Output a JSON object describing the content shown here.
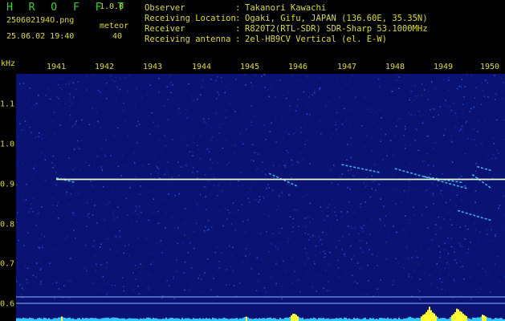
{
  "header": {
    "app_name": "H R O F F T",
    "version": "1.0.0",
    "filename": "250602194O.png",
    "meteor_label": "meteor",
    "timestamp": "25.06.02 19:40",
    "meteor_count": "40",
    "info": [
      {
        "key": "Observer",
        "value": "Takanori Kawachi"
      },
      {
        "key": "Receiving Location",
        "value": "Ogaki, Gifu, JAPAN (136.60E, 35.35N)"
      },
      {
        "key": "Receiver",
        "value": "R820T2(RTL-SDR) SDR-Sharp 53.1000MHz"
      },
      {
        "key": "Receiving antenna",
        "value": "2el-HB9CV Vertical (el. E-W)"
      }
    ]
  },
  "axis": {
    "unit": "kHz",
    "x_ticks": [
      "1941",
      "1942",
      "1943",
      "1944",
      "1945",
      "1946",
      "1947",
      "1948",
      "1949",
      "1950"
    ],
    "y_ticks": [
      "1.1",
      "1.0",
      "0.9",
      "0.8",
      "0.7",
      "0.6"
    ]
  },
  "chart_data": {
    "type": "heatmap",
    "x_label": "",
    "y_label": "kHz",
    "x_range": [
      1940.0,
      1950.0
    ],
    "y_range": [
      0.58,
      1.18
    ],
    "carrier_khz": 0.913,
    "carrier_start": 1941.0,
    "echoes": [
      {
        "t0": 1941.0,
        "f0": 0.917,
        "t1": 1941.4,
        "f1": 0.905
      },
      {
        "t0": 1945.4,
        "f0": 0.928,
        "t1": 1946.0,
        "f1": 0.895
      },
      {
        "t0": 1946.9,
        "f0": 0.95,
        "t1": 1947.7,
        "f1": 0.93
      },
      {
        "t0": 1948.0,
        "f0": 0.94,
        "t1": 1949.5,
        "f1": 0.89
      },
      {
        "t0": 1948.6,
        "f0": 0.92,
        "t1": 1949.4,
        "f1": 0.905
      },
      {
        "t0": 1949.6,
        "f0": 0.925,
        "t1": 1950.0,
        "f1": 0.89
      },
      {
        "t0": 1949.3,
        "f0": 0.835,
        "t1": 1950.0,
        "f1": 0.81
      },
      {
        "t0": 1949.7,
        "f0": 0.945,
        "t1": 1950.0,
        "f1": 0.935
      }
    ],
    "level_peaks": [
      {
        "t": 1941.1,
        "h": 0.35
      },
      {
        "t": 1942.0,
        "h": 0.25
      },
      {
        "t": 1942.2,
        "h": 0.3
      },
      {
        "t": 1944.9,
        "h": 0.35
      },
      {
        "t": 1945.9,
        "h": 0.55
      },
      {
        "t": 1946.8,
        "h": 0.25
      },
      {
        "t": 1948.3,
        "h": 0.3
      },
      {
        "t": 1948.7,
        "h": 1.0
      },
      {
        "t": 1949.3,
        "h": 1.0
      },
      {
        "t": 1949.8,
        "h": 0.45
      }
    ],
    "colors": {
      "background": "#0a1273",
      "carrier": "#eaffd0",
      "echo": "#4ac8ff",
      "level": "#ffff33",
      "level_base": "#33c8ff"
    }
  }
}
